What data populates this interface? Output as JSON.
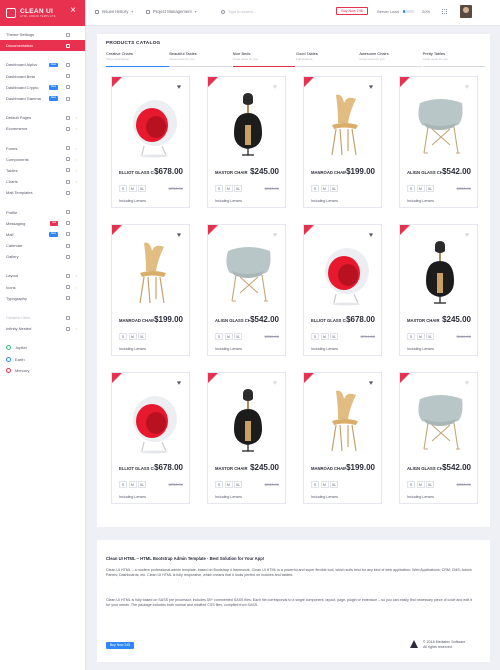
{
  "brand": {
    "title": "CLEAN UI",
    "subtitle": "HTML ADMIN TEMPLATE"
  },
  "sidebar": {
    "items": [
      {
        "label": "Theme Settings",
        "icon": "gear-icon"
      },
      {
        "label": "Documentation",
        "icon": "book-icon",
        "active": true
      },
      {
        "label": "Dashboard Alpha",
        "icon": "home-icon",
        "badge": "New"
      },
      {
        "label": "Dashboard Beta",
        "icon": "home-icon"
      },
      {
        "label": "Dashboard Crypto",
        "icon": "home-icon",
        "badge": "New"
      },
      {
        "label": "Dashboard Gamma",
        "icon": "home-icon",
        "badge": "New"
      },
      {
        "label": "Default Pages",
        "icon": "file-icon",
        "chevron": true
      },
      {
        "label": "Ecommerce",
        "icon": "cart-icon",
        "chevron": true
      },
      {
        "label": "Forms",
        "icon": "form-icon",
        "chevron": true
      },
      {
        "label": "Components",
        "icon": "puzzle-icon",
        "chevron": true
      },
      {
        "label": "Tables",
        "icon": "table-icon",
        "chevron": true
      },
      {
        "label": "Charts",
        "icon": "chart-icon",
        "chevron": true
      },
      {
        "label": "Mail Templates",
        "icon": "mail-icon"
      },
      {
        "label": "Profile",
        "icon": "user-icon"
      },
      {
        "label": "Messaging",
        "icon": "chat-icon",
        "badge": "Hot"
      },
      {
        "label": "Mail",
        "icon": "mail-icon",
        "badge": "New"
      },
      {
        "label": "Calendar",
        "icon": "calendar-icon"
      },
      {
        "label": "Gallery",
        "icon": "image-icon"
      },
      {
        "label": "Layout",
        "icon": "layout-icon",
        "chevron": true
      },
      {
        "label": "Icons",
        "icon": "star-icon",
        "chevron": true
      },
      {
        "label": "Typography",
        "icon": "text-icon"
      },
      {
        "label": "Disabled Item",
        "icon": "lock-icon",
        "muted": true
      },
      {
        "label": "Infinity Nested",
        "icon": "layers-icon",
        "chevron": true
      }
    ],
    "planets": [
      {
        "label": "Jupiter",
        "color": "#2dc07c"
      },
      {
        "label": "Earth",
        "color": "#2f86f6"
      },
      {
        "label": "Mercury",
        "color": "#e8304f"
      }
    ]
  },
  "topbar": {
    "menu1": "Issues History",
    "menu2": "Project Management",
    "search_placeholder": "Type to search...",
    "buy": "Buy Now 24$",
    "server_label": "Server Load",
    "server_pct": "20%",
    "server_fraction": 0.2
  },
  "catalog": {
    "title": "PRODUCTS CATALOG",
    "tabs": [
      {
        "name": "Creative Chairs",
        "sub": "Some description"
      },
      {
        "name": "Beautiful Tables",
        "sub": "Great news for you"
      },
      {
        "name": "Nice Beds",
        "sub": "Great news for you"
      },
      {
        "name": "Good Tables",
        "sub": "Full features"
      },
      {
        "name": "Awesome Chairs",
        "sub": "Great news for you"
      },
      {
        "name": "Pretty Tables",
        "sub": "Great news for you"
      }
    ],
    "sizes": [
      "S",
      "M",
      "XL"
    ],
    "lenses": "Including Lenses",
    "products": [
      {
        "name": "ELLIOT GLASS CHAIR",
        "price": "$678.00",
        "old": "$754.00",
        "image": "egg-chair",
        "heart": "#5f5b7e"
      },
      {
        "name": "MAXTOR CHAIR",
        "price": "$245.00",
        "old": "$166.00",
        "image": "black-chair",
        "heart": "#d8d9e0"
      },
      {
        "name": "MANROAD CHAIR",
        "price": "$199.00",
        "old": "",
        "image": "wood-chair",
        "heart": "#5f5b7e"
      },
      {
        "name": "ALIGN GLASS CHAIR",
        "price": "$542.00",
        "old": "$356.00",
        "image": "shell-chair",
        "heart": "#d8d9e0"
      },
      {
        "name": "MANROAD CHAIR",
        "price": "$199.00",
        "old": "",
        "image": "wood-chair",
        "heart": "#5f5b7e"
      },
      {
        "name": "ALIGN GLASS CHAIR",
        "price": "$542.00",
        "old": "$356.00",
        "image": "shell-chair",
        "heart": "#d8d9e0"
      },
      {
        "name": "ELLIOT GLASS CHAIR",
        "price": "$678.00",
        "old": "$754.00",
        "image": "egg-chair",
        "heart": "#5f5b7e"
      },
      {
        "name": "MAXTOR CHAIR",
        "price": "$245.00",
        "old": "$166.00",
        "image": "black-chair",
        "heart": "#d8d9e0"
      },
      {
        "name": "ELLIOT GLASS CHAIR",
        "price": "$678.00",
        "old": "$754.00",
        "image": "egg-chair",
        "heart": "#5f5b7e"
      },
      {
        "name": "MAXTOR CHAIR",
        "price": "$245.00",
        "old": "$166.00",
        "image": "black-chair",
        "heart": "#d8d9e0"
      },
      {
        "name": "MANROAD CHAIR",
        "price": "$199.00",
        "old": "",
        "image": "wood-chair",
        "heart": "#5f5b7e"
      },
      {
        "name": "ALIGN GLASS CHAIR",
        "price": "$542.00",
        "old": "$356.00",
        "image": "shell-chair",
        "heart": "#d8d9e0"
      }
    ]
  },
  "footer": {
    "title": "Clean UI HTML – HTML Bootstrap Admin Template - Best Solution for Your App!",
    "p1": "Clean UI HTML – a modern professional admin template, based on Bootstrap 4 framework. Clean UI HTML is a powerful and super flexible tool, which suits best for any kind of web application: Web Applications; CRM; CMS; Admin Panels; Dashboards; etc. Clean UI HTML is fully responsive, which means that it looks perfect on mobiles and tablets.",
    "p2": "Clean UI HTML is fully based on SASS pre processor, includes 50+ commented SASS files. Each file corresponds to a single component, layout, page, plugin or extension – so you can easily find necessary piece of code and edit it for your needs. The package includes both normal and minified CSS files, compiled from SASS.",
    "buy": "Buy Now 24$",
    "copy1": "© 2018 Mediatec Software",
    "copy2": "All rights reserved"
  },
  "colors": {
    "accent": "#e8304f",
    "blue": "#2f86f6"
  }
}
